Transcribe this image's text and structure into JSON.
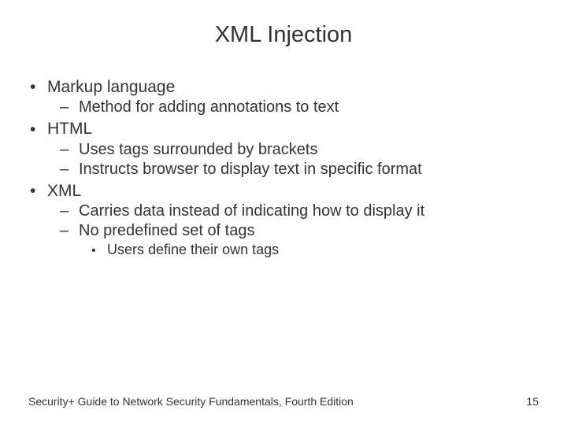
{
  "title": "XML Injection",
  "bullets": [
    {
      "text": "Markup language",
      "sub": [
        {
          "text": "Method for adding annotations to text"
        }
      ]
    },
    {
      "text": "HTML",
      "sub": [
        {
          "text": "Uses tags surrounded by brackets"
        },
        {
          "text": "Instructs browser to display text in specific format"
        }
      ]
    },
    {
      "text": "XML",
      "sub": [
        {
          "text": "Carries data instead of indicating how to display it"
        },
        {
          "text": "No predefined set of tags",
          "sub": [
            {
              "text": "Users define their own tags"
            }
          ]
        }
      ]
    }
  ],
  "footer": {
    "source": "Security+ Guide to Network Security Fundamentals, Fourth Edition",
    "page": "15"
  }
}
